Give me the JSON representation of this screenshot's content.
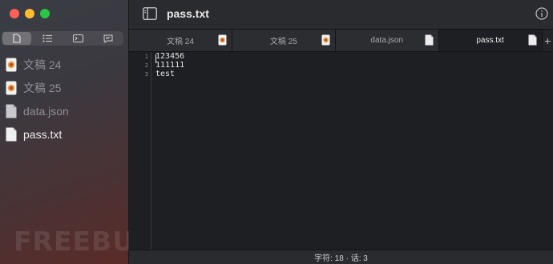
{
  "sidebar": {
    "items": [
      {
        "label": "文稿 24",
        "icon": "draft-doc-icon"
      },
      {
        "label": "文稿 25",
        "icon": "draft-doc-icon"
      },
      {
        "label": "data.json",
        "icon": "document-icon"
      },
      {
        "label": "pass.txt",
        "icon": "document-icon"
      }
    ],
    "watermark": "FREEBUF"
  },
  "titlebar": {
    "title": "pass.txt"
  },
  "tabs": [
    {
      "label": "文稿 24"
    },
    {
      "label": "文稿 25"
    },
    {
      "label": "data.json"
    },
    {
      "label": "pass.txt"
    }
  ],
  "tab_add": "+",
  "editor": {
    "lines": [
      {
        "num": "1",
        "text": "123456"
      },
      {
        "num": "2",
        "text": "111111"
      },
      {
        "num": "3",
        "text": "test"
      }
    ]
  },
  "status": {
    "text": "字符: 18 · 话: 3"
  },
  "colors": {
    "close": "#ff5f57",
    "minimize": "#febc2e",
    "maximize": "#28c840",
    "draft_icon": "#e0a040"
  }
}
